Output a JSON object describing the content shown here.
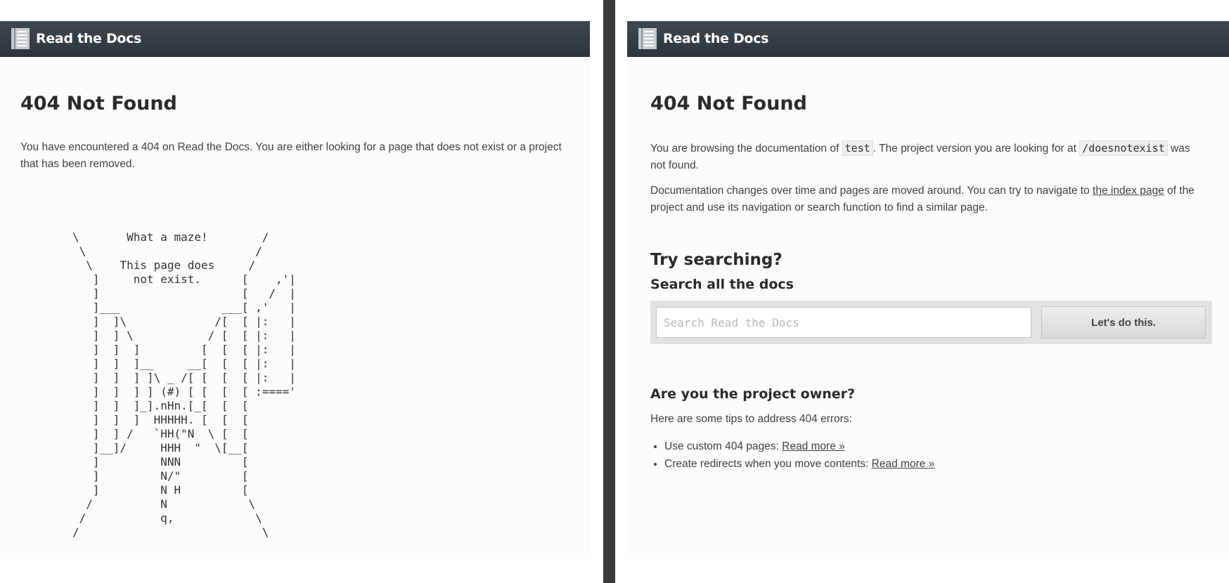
{
  "left": {
    "brand": "Read the Docs",
    "title": "404 Not Found",
    "description": "You have encountered a 404 on Read the Docs. You are either looking for a page that does not exist or a project that has been removed.",
    "maze_art": "\\       What a maze!        /\n \\                         /\n  \\    This page does     /\n   ]     not exist.      [    ,'|\n   ]                     [   /  |\n   ]___               ___[ ,'   |\n   ]  ]\\             /[  [ |:   |\n   ]  ] \\           / [  [ |:   |\n   ]  ]  ]         [  [  [ |:   |\n   ]  ]  ]__     __[  [  [ |:   |\n   ]  ]  ] ]\\ _ /[ [  [  [ |:   |\n   ]  ]  ] ] (#) [ [  [  [ :===='\n   ]  ]  ]_].nHn.[_[  [  [\n   ]  ]  ]  HHHHH. [  [  [\n   ]  ] /   `HH(\"N  \\ [  [\n   ]__]/     HHH  \"  \\[__[\n   ]         NNN         [\n   ]         N/\"         [\n   ]         N H         [\n  /          N            \\\n /           q,            \\\n/                           \\"
  },
  "right": {
    "brand": "Read the Docs",
    "title": "404 Not Found",
    "browse_prefix": "You are browsing the documentation of ",
    "project_name": "test",
    "browse_middle": ". The project version you are looking for at ",
    "missing_path": "/doesnotexist",
    "browse_suffix": " was not found.",
    "changes_prefix": "Documentation changes over time and pages are moved around. You can try to navigate to ",
    "index_link": "the index page",
    "changes_suffix": " of the project and use its navigation or search function to find a similar page.",
    "try_title": "Try searching?",
    "search_all_title": "Search all the docs",
    "search_placeholder": "Search Read the Docs",
    "search_button": "Let's do this.",
    "owner_title": "Are you the project owner?",
    "owner_desc": "Here are some tips to address 404 errors:",
    "tips": [
      {
        "text": "Use custom 404 pages: ",
        "link": "Read more »"
      },
      {
        "text": "Create redirects when you move contents: ",
        "link": "Read more »"
      }
    ]
  },
  "colors": {
    "topbar": "#343c44",
    "divider": "#3a3a3a",
    "panel_bg": "#fcfcfc",
    "search_box": "#e2e2e2"
  },
  "icons": {
    "logo": "book-icon"
  }
}
